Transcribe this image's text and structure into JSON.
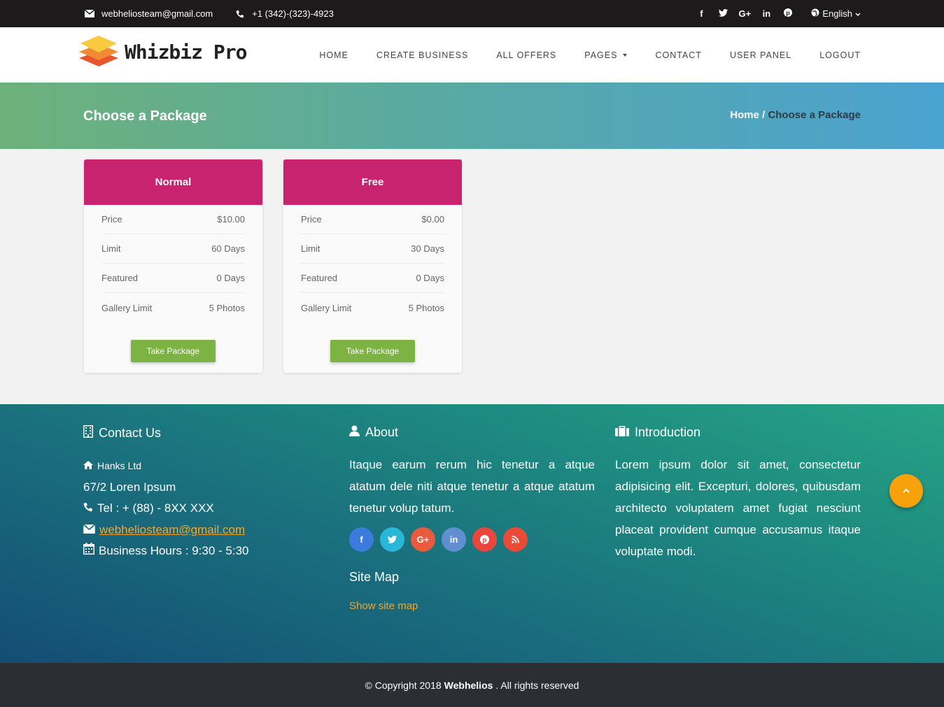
{
  "topbar": {
    "email": "webheliosteam@gmail.com",
    "phone": "+1 (342)-(323)-4923",
    "social": [
      "f",
      "t",
      "G+",
      "in",
      "p"
    ],
    "language": "English"
  },
  "header": {
    "logo_text": "Whizbiz Pro",
    "nav": [
      {
        "label": "HOME"
      },
      {
        "label": "CREATE BUSINESS"
      },
      {
        "label": "ALL OFFERS"
      },
      {
        "label": "PAGES"
      },
      {
        "label": "CONTACT"
      },
      {
        "label": "USER PANEL"
      },
      {
        "label": "LOGOUT"
      }
    ]
  },
  "hero": {
    "title": "Choose a Package",
    "breadcrumb_home": "Home",
    "breadcrumb_sep": " / ",
    "breadcrumb_current": "Choose a Package"
  },
  "packages": [
    {
      "name": "Normal",
      "rows": [
        {
          "label": "Price",
          "value": "$10.00"
        },
        {
          "label": "Limit",
          "value": "60 Days"
        },
        {
          "label": "Featured",
          "value": "0 Days"
        },
        {
          "label": "Gallery Limit",
          "value": "5 Photos"
        }
      ],
      "button": "Take Package"
    },
    {
      "name": "Free",
      "rows": [
        {
          "label": "Price",
          "value": "$0.00"
        },
        {
          "label": "Limit",
          "value": "30 Days"
        },
        {
          "label": "Featured",
          "value": "0 Days"
        },
        {
          "label": "Gallery Limit",
          "value": "5 Photos"
        }
      ],
      "button": "Take Package"
    }
  ],
  "footer": {
    "contact": {
      "title": "Contact Us",
      "company": "Hanks Ltd",
      "address": "67/2 Loren Ipsum",
      "tel": "Tel : + (88) - 8XX XXX",
      "email": "webheliosteam@gmail.com",
      "hours": "Business Hours : 9:30 - 5:30"
    },
    "about": {
      "title": "About",
      "text": "Itaque earum rerum hic tenetur a atque atatum dele niti atque tenetur a atque atatum tenetur volup tatum.",
      "social": [
        {
          "glyph": "f",
          "color": "#3b7be0"
        },
        {
          "glyph": "t",
          "color": "#29b6d8"
        },
        {
          "glyph": "G+",
          "color": "#ea5a3c"
        },
        {
          "glyph": "in",
          "color": "#5f8fd0"
        },
        {
          "glyph": "p",
          "color": "#e9473d"
        },
        {
          "glyph": "rss",
          "color": "#ea4a37"
        }
      ],
      "sitemap_title": "Site Map",
      "sitemap_link": "Show site map"
    },
    "intro": {
      "title": "Introduction",
      "text": "Lorem ipsum dolor sit amet, consectetur adipisicing elit. Excepturi, dolores, quibusdam architecto voluptatem amet fugiat nesciunt placeat provident cumque accusamus itaque voluptate modi."
    }
  },
  "copyright": {
    "prefix": "© Copyright 2018",
    "brand": "Webhelios",
    "suffix": ". All rights reserved"
  },
  "colors": {
    "package_header": "#c7236e",
    "button": "#7cb342",
    "accent": "#f4a52b"
  }
}
